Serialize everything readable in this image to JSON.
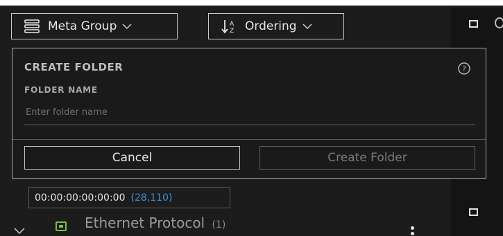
{
  "toolbar": {
    "meta_group_label": "Meta Group",
    "ordering_label": "Ordering",
    "meta_group_icon": "list-icon",
    "ordering_icon": "sort-az-icon"
  },
  "dialog": {
    "title": "CREATE FOLDER",
    "field_label": "FOLDER NAME",
    "field_placeholder": "Enter folder name",
    "field_value": "",
    "cancel_label": "Cancel",
    "create_label": "Create Folder"
  },
  "list": {
    "chip_value": "00:00:00:00:00:00",
    "chip_count": "(28,110)",
    "row_label": "Ethernet Protocol",
    "row_count": "(1)"
  },
  "colors": {
    "background": "#1c1c1c",
    "accent_count": "#3d8fd6",
    "ethernet_icon": "#7bbf3a"
  }
}
